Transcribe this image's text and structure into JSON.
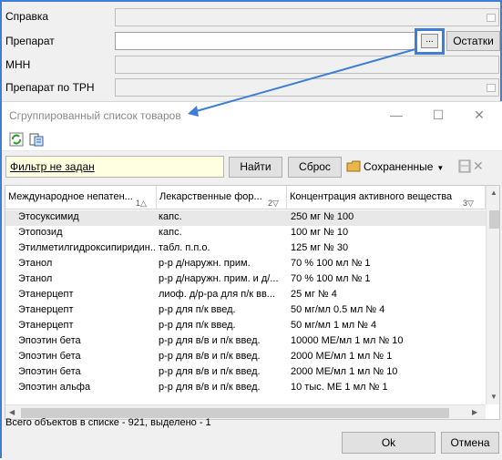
{
  "form": {
    "labels": [
      "Справка",
      "Препарат",
      "МНН",
      "Препарат по ТРН"
    ],
    "lookup_label": "...",
    "ostatki_label": "Остатки"
  },
  "dialog": {
    "title": "Сгруппированный список товаров",
    "window_icons": [
      "minimize-icon",
      "maximize-icon",
      "close-icon"
    ],
    "toolbar_icons": [
      "refresh-icon",
      "export-icon"
    ],
    "filter_text": "Фильтр не задан",
    "find_label": "Найти",
    "reset_label": "Сброс",
    "saved_label": "Сохраненные",
    "columns": [
      "Международное непатен...",
      "Лекарственные фор...",
      "Концентрация активного вещества"
    ],
    "rows": [
      [
        "Этосуксимид",
        "капс.",
        "250 мг № 100"
      ],
      [
        "Этопозид",
        "капс.",
        "100 мг № 10"
      ],
      [
        "Этилметилгидроксипиридин...",
        "табл. п.п.о.",
        "125 мг № 30"
      ],
      [
        "Этанол",
        "р-р д/наружн. прим.",
        "70 % 100 мл № 1"
      ],
      [
        "Этанол",
        "р-р д/наружн. прим. и д/...",
        "70 % 100 мл № 1"
      ],
      [
        "Этанерцепт",
        "лиоф. д/р-ра для п/к вв...",
        "25 мг № 4"
      ],
      [
        "Этанерцепт",
        "р-р для п/к введ.",
        "50 мг/мл 0.5 мл № 4"
      ],
      [
        "Этанерцепт",
        "р-р для п/к введ.",
        "50 мг/мл 1 мл № 4"
      ],
      [
        "Эпоэтин бета",
        "р-р для в/в и п/к введ.",
        "10000 МЕ/мл 1 мл № 10"
      ],
      [
        "Эпоэтин бета",
        "р-р для в/в и п/к введ.",
        "2000 МЕ/мл 1 мл № 1"
      ],
      [
        "Эпоэтин бета",
        "р-р для в/в и п/к введ.",
        "2000 МЕ/мл 1 мл № 10"
      ],
      [
        "Эпоэтин альфа",
        "р-р для в/в и п/к введ.",
        "10 тыс. МЕ 1 мл № 1"
      ]
    ],
    "status": "Всего объектов в списке - 921, выделено - 1",
    "ok_label": "Ok",
    "cancel_label": "Отмена"
  },
  "colors": {
    "accent": "#3d7fd6",
    "filter_bg": "#ffffe1",
    "selected_row": "#e8e8e8"
  }
}
